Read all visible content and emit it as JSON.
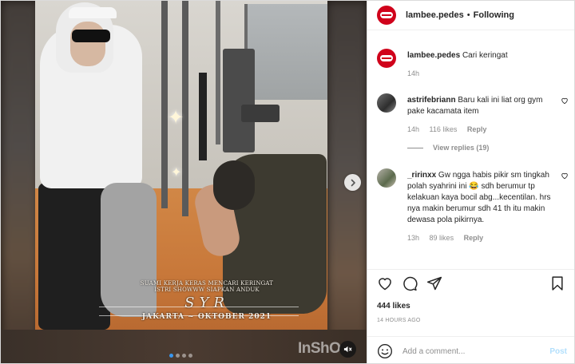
{
  "post": {
    "author": "lambee.pedes",
    "separator": "•",
    "follow_status": "Following"
  },
  "caption": {
    "author": "lambee.pedes",
    "text": "Cari keringat",
    "time": "14h"
  },
  "comments": [
    {
      "author": "astrifebriann",
      "text": "Baru kali ini liat org gym pake kacamata item",
      "time": "14h",
      "likes": "116 likes",
      "reply": "Reply",
      "view_replies": "View replies (19)"
    },
    {
      "author": "_ririnxx",
      "text": "Gw ngga habis pikir sm tingkah polah syahrini ini 😂 sdh berumur tp kelakuan kaya bocil abg...kecentilan. hrs nya makin berumur sdh 41 th itu makin dewasa pola pikirnya.",
      "time": "13h",
      "likes": "89 likes",
      "reply": "Reply"
    }
  ],
  "stats": {
    "likes": "444 likes",
    "time_ago": "14 HOURS AGO"
  },
  "composer": {
    "placeholder": "Add a comment...",
    "post_label": "Post"
  },
  "video_overlay": {
    "line1": "SUAMI KERJA KERAS MENCARI KERINGAT",
    "line2": "ISTRI SHOWWW SIAPKAN ANDUK",
    "monogram": "SYR",
    "line4": "JAKARTA ~ OKTOBER 2021",
    "watermark": "InShO"
  },
  "carousel": {
    "count": 4,
    "active_index": 0
  },
  "colors": {
    "brand_avatar": "#d0021b",
    "link_blue": "#3897f0",
    "post_disabled": "#b2dffc",
    "muted_text": "#8e8e8e"
  },
  "icons": [
    "heart-icon",
    "comment-icon",
    "share-icon",
    "bookmark-icon",
    "smiley-icon",
    "chevron-right-icon",
    "mute-icon"
  ]
}
